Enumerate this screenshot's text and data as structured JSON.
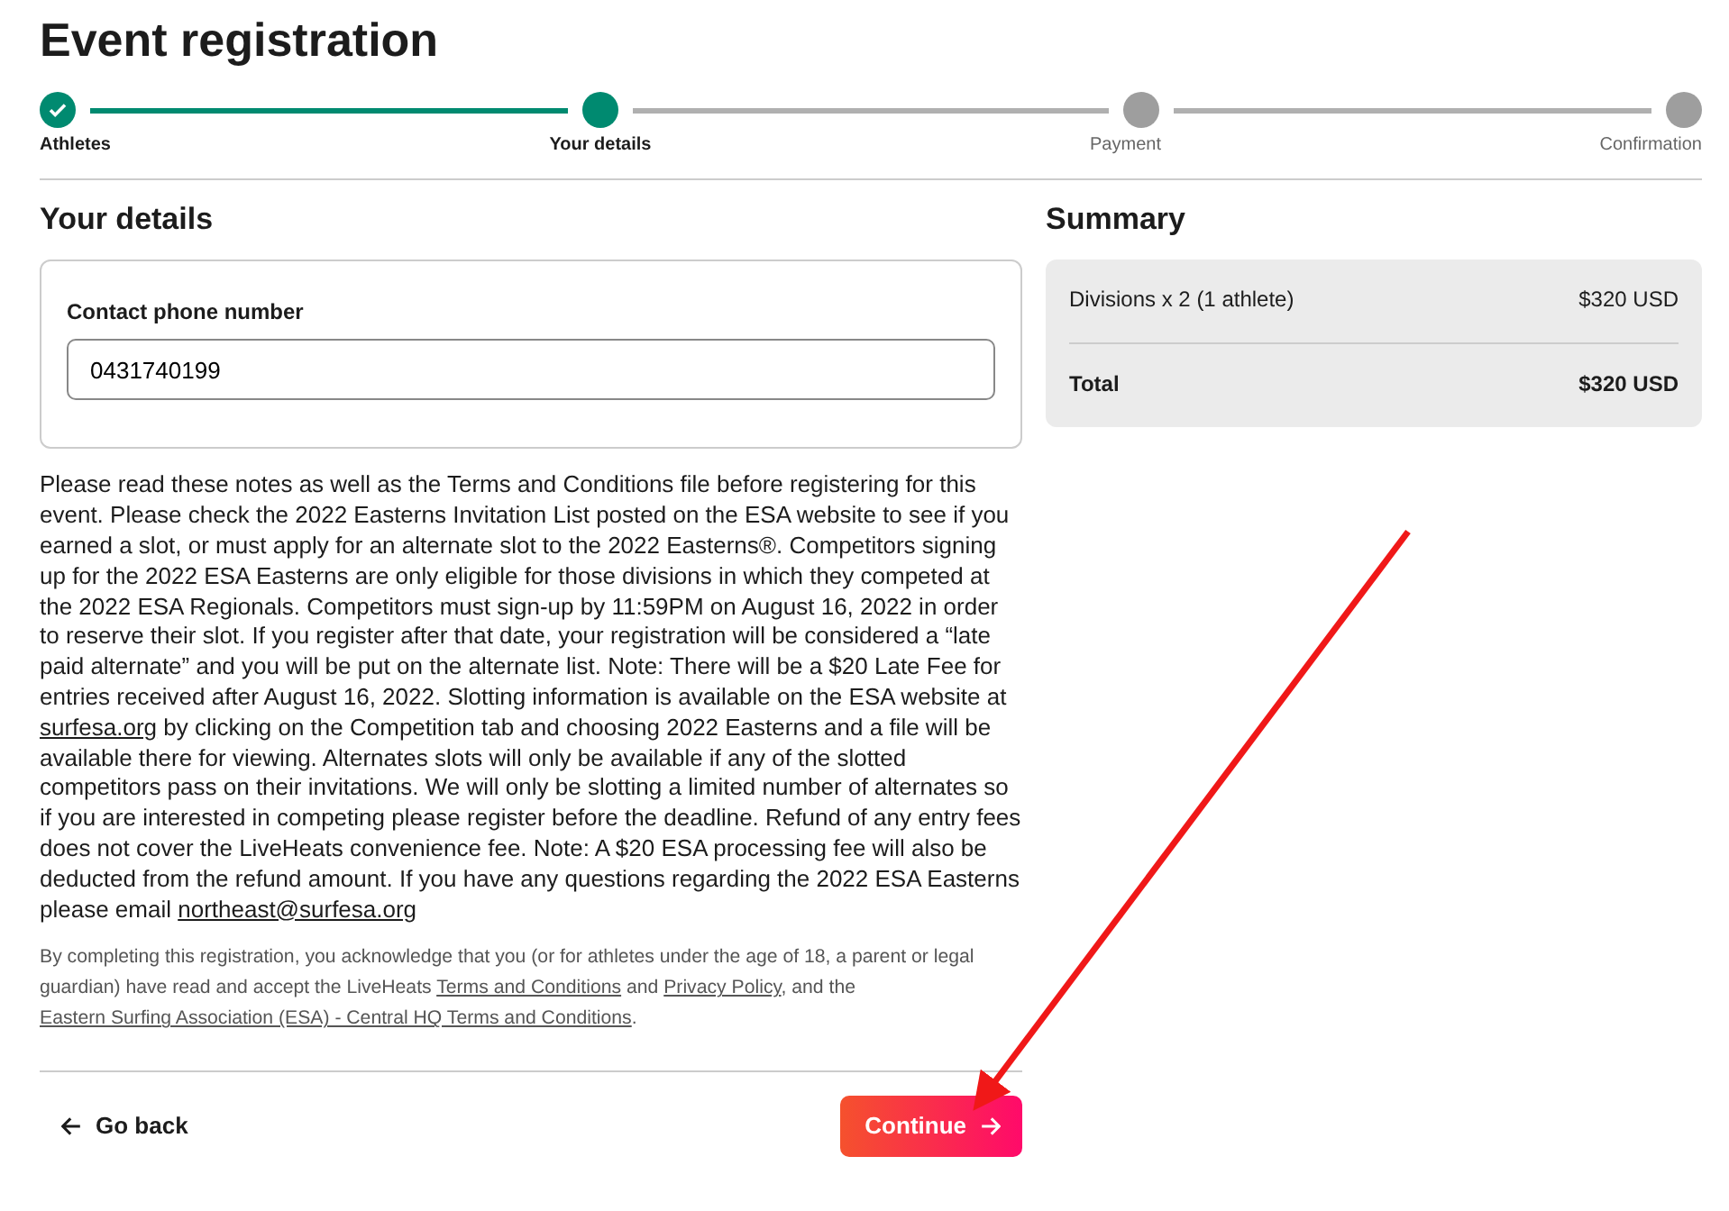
{
  "page_title": "Event registration",
  "steps": [
    {
      "label": "Athletes",
      "kind": "done"
    },
    {
      "label": "Your details",
      "kind": "current"
    },
    {
      "label": "Payment",
      "kind": "upcoming"
    },
    {
      "label": "Confirmation",
      "kind": "upcoming"
    }
  ],
  "details": {
    "heading": "Your details",
    "field_label": "Contact phone number",
    "field_value": "0431740199"
  },
  "notes": [
    {
      "kind": "text",
      "text": "Please read these notes as well as the Terms and Conditions file before registering for this event. Please check the 2022 Easterns Invitation List posted on the ESA website to see if you earned a slot, or must apply for an alternate slot to the 2022 Easterns®. Competitors signing up for the 2022 ESA Easterns are only eligible for those divisions in which they competed at the 2022 ESA Regionals. Competitors must sign-up by 11:59PM on August 16, 2022 in order to reserve their slot. If you register after that date, your registration will be considered a “late paid alternate” and you will be put on the alternate list. Note: There will be a $20 Late Fee for entries received after August 16, 2022. Slotting information is available on the ESA website at "
    },
    {
      "kind": "link",
      "text": "surfesa.org"
    },
    {
      "kind": "text",
      "text": " by clicking on the Competition tab and choosing 2022 Easterns and a file will be available there for viewing. Alternates slots will only be available if any of the slotted competitors pass on their invitations. We will only be slotting a limited number of alternates so if you are interested in competing please register before the deadline. Refund of any entry fees does not cover the LiveHeats convenience fee. Note: A $20 ESA processing fee will also be deducted from the refund amount. If you have any questions regarding the 2022 ESA Easterns please email "
    },
    {
      "kind": "link",
      "text": "northeast@surfesa.org"
    }
  ],
  "legal": [
    {
      "kind": "text",
      "text": "By completing this registration, you acknowledge that you (or for athletes under the age of 18, a parent or legal guardian) have read and accept the LiveHeats "
    },
    {
      "kind": "link",
      "text": "Terms and Conditions"
    },
    {
      "kind": "text",
      "text": " and "
    },
    {
      "kind": "link",
      "text": "Privacy Policy"
    },
    {
      "kind": "text",
      "text": ", and the "
    },
    {
      "kind": "link",
      "text": "Eastern Surfing Association (ESA) - Central HQ Terms and Conditions"
    },
    {
      "kind": "text",
      "text": "."
    }
  ],
  "back_button": "Go back",
  "continue_button": "Continue",
  "summary": {
    "heading": "Summary",
    "rows": [
      {
        "kind": "item",
        "label": "Divisions x 2 (1 athlete)",
        "amount": "$320 USD"
      },
      {
        "kind": "total",
        "label": "Total",
        "amount": "$320 USD"
      }
    ]
  }
}
